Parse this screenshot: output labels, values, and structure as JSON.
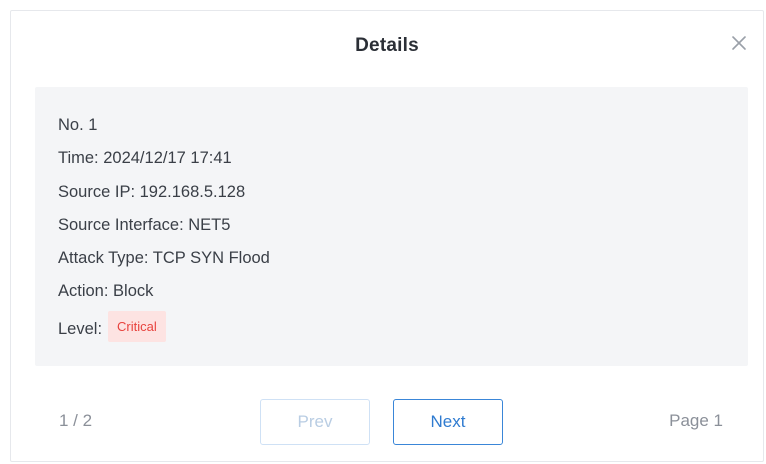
{
  "dialog": {
    "title": "Details"
  },
  "details": {
    "no": "No. 1",
    "time": "Time: 2024/12/17 17:41",
    "source_ip": "Source IP: 192.168.5.128",
    "source_interface": "Source Interface: NET5",
    "attack_type": "Attack Type: TCP SYN Flood",
    "action": "Action: Block",
    "level_label": "Level:",
    "level_value": "Critical"
  },
  "footer": {
    "count": "1 / 2",
    "prev_label": "Prev",
    "next_label": "Next",
    "page_label": "Page 1"
  },
  "colors": {
    "critical_text": "#e8433e",
    "critical_bg": "#fde3e2",
    "primary": "#2f7bd0"
  }
}
